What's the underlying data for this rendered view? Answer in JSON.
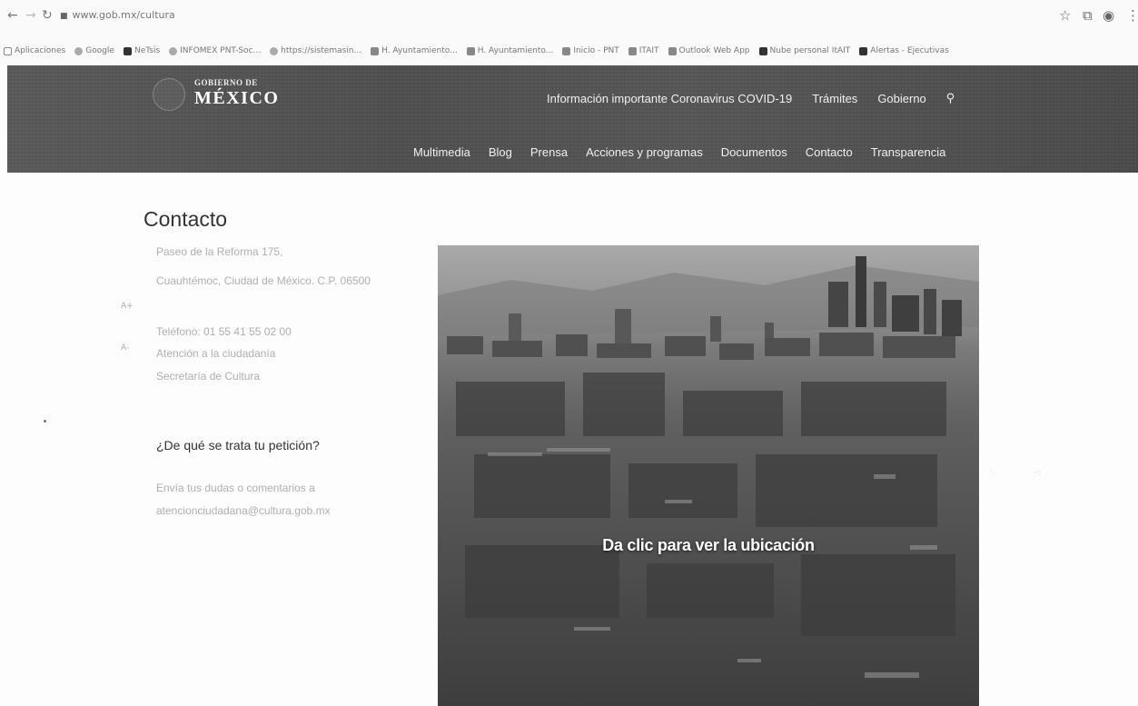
{
  "browser": {
    "url": "www.gob.mx/cultura",
    "bookmarks": [
      {
        "label": "Aplicaciones",
        "icon": "apps-icon"
      },
      {
        "label": "Google",
        "icon": "google-icon"
      },
      {
        "label": "NeTsis",
        "icon": "bookmark-icon"
      },
      {
        "label": "INFOMEX PNT-Soc...",
        "icon": "globe-icon"
      },
      {
        "label": "https://sistemasin...",
        "icon": "globe-icon"
      },
      {
        "label": "H. Ayuntamiento...",
        "icon": "crest-icon"
      },
      {
        "label": "H. Ayuntamiento...",
        "icon": "crest-icon"
      },
      {
        "label": "Inicio - PNT",
        "icon": "pnt-icon"
      },
      {
        "label": "ITAIT",
        "icon": "itait-icon"
      },
      {
        "label": "Outlook Web App",
        "icon": "outlook-icon"
      },
      {
        "label": "Nube personal ItAIT",
        "icon": "cloud-icon"
      },
      {
        "label": "Alertas - Ejecutivas",
        "icon": "alert-icon"
      }
    ]
  },
  "header": {
    "logo_small": "GOBIERNO DE",
    "logo_big": "MÉXICO",
    "top_nav": [
      "Información importante Coronavirus COVID-19",
      "Trámites",
      "Gobierno"
    ],
    "sub_nav": [
      "Multimedia",
      "Blog",
      "Prensa",
      "Acciones y programas",
      "Documentos",
      "Contacto",
      "Transparencia"
    ]
  },
  "contact": {
    "title": "Contacto",
    "address_line1": "Paseo de la Reforma 175,",
    "address_line2": "Cuauhtémoc, Ciudad de México. C.P. 06500",
    "phone": "Teléfono: 01 55 41 55 02 00",
    "attention_line1": "Atención a la ciudadanía",
    "attention_line2": "Secretaría de Cultura",
    "side_mark_1": "A+",
    "side_mark_2": "A-",
    "question": "¿De qué se trata tu petición?",
    "email_line1": "Envía tus dudas o comentarios a",
    "email_line2": "atencionciudadana@cultura.gob.mx"
  },
  "map": {
    "caption": "Da clic para ver la ubicación"
  }
}
